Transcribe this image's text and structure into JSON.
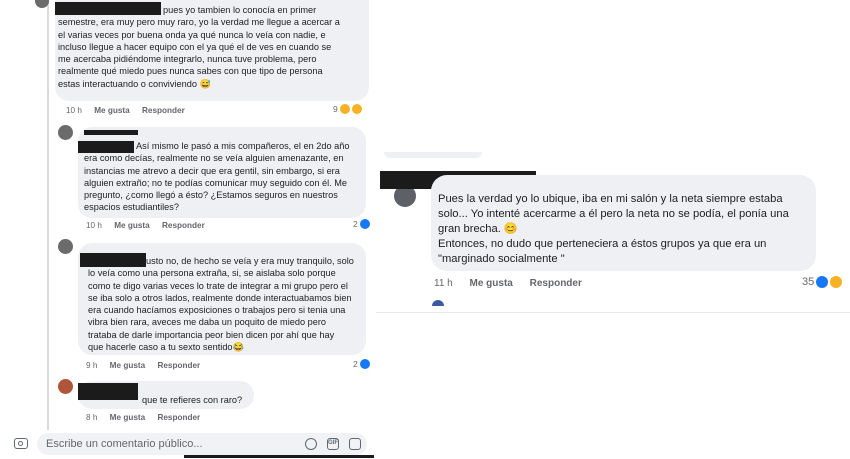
{
  "left_thread": {
    "comments": [
      {
        "text": "pues yo tambien lo conocía en primer\nsemestre, era muy pero muy raro, yo la verdad me llegue a acercar a\nel varias veces por buena onda ya qué nunca lo veía con nadie, e\nincluso llegue a hacer equipo con el ya qué el de ves en cuando se\nme acercaba pidiéndome integrarlo, nunca tuve problema, pero\nrealmente qué miedo pues nunca sabes con que tipo de persona\nestas interactuando o conviviendo 😅",
        "time": "10 h",
        "like": "Me gusta",
        "reply": "Responder",
        "reactions": "9"
      },
      {
        "text": "Así mismo le pasó a mis compañeros, el en 2do año\nera como decías, realmente no se veía alguien amenazante, en\ninstancias me atrevo a decir que era gentil, sin embargo, si era\nalguien extraño; no te podías comunicar muy seguido con él. Me\npregunto, ¿como llegó a ésto? ¿Estamos seguros en nuestros\nespacios estudiantiles?",
        "time": "10 h",
        "like": "Me gusta",
        "reply": "Responder",
        "reactions": "2"
      },
      {
        "text": "justo no, de hecho se veía y era muy tranquilo, solo\nlo veía como una persona extraña, si, se aislaba solo porque\ncomo te digo varias veces lo trate de integrar a mi grupo pero el\nse iba solo a otros lados, realmente donde interactuabamos bien\nera cuando hacíamos exposiciones o trabajos pero si tenia una\nvibra bien rara, aveces me daba un poquito de miedo pero\ntrataba de  darle importancia peor bien dicen por ahí que hay\nque hacerle caso a tu sexto sentido😂",
        "time": "9 h",
        "like": "Me gusta",
        "reply": "Responder",
        "reactions": "2"
      },
      {
        "text": "que te refieres con raro?",
        "time": "8 h",
        "like": "Me gusta",
        "reply": "Responder"
      }
    ],
    "composer": {
      "placeholder": "Escribe un comentario público..."
    }
  },
  "right_comment": {
    "text": "Pues la verdad yo lo ubique, iba en mi salón y la neta siempre estaba\nsolo... Yo intenté acercarme a él pero la neta no se podía, el ponía una\ngran brecha. 😊\nEntonces, no dudo que perteneciera a éstos grupos ya que era un\n\"marginado socialmente \"",
    "time": "11 h",
    "like": "Me gusta",
    "reply": "Responder",
    "reactions": "35"
  },
  "colors": {
    "bubble": "#eef0f3",
    "like": "#1877f2",
    "wow": "#f7b125",
    "meta": "#65676b"
  }
}
